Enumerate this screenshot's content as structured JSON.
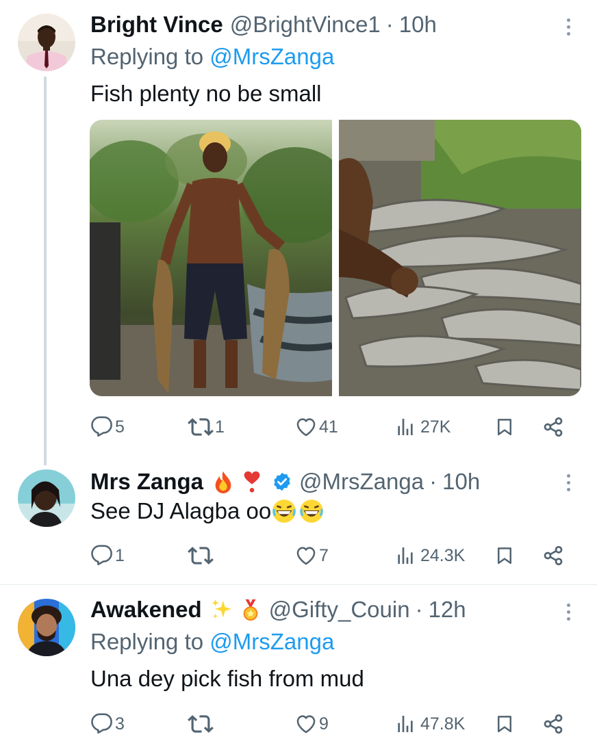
{
  "tweets": [
    {
      "name": "Bright Vince",
      "handle": "@BrightVince1",
      "time": "10h",
      "replying_prefix": "Replying to",
      "replying_to": "@MrsZanga",
      "text": "Fish plenty no be small",
      "stats": {
        "replies": "5",
        "retweets": "1",
        "likes": "41",
        "views": "27K"
      }
    },
    {
      "name": "Mrs Zanga",
      "handle": "@MrsZanga",
      "time": "10h",
      "text": "See DJ Alagba oo",
      "verified": true,
      "stats": {
        "replies": "1",
        "retweets": "",
        "likes": "7",
        "views": "24.3K"
      }
    },
    {
      "name": "Awakened",
      "handle": "@Gifty_Couin",
      "time": "12h",
      "replying_prefix": "Replying to",
      "replying_to": "@MrsZanga",
      "text": "Una dey pick fish from mud",
      "stats": {
        "replies": "3",
        "retweets": "",
        "likes": "9",
        "views": "47.8K"
      }
    }
  ],
  "colors": {
    "accent": "#1d9bf0",
    "secondary": "#536471",
    "text": "#0f1419",
    "verified": "#1d9bf0"
  },
  "icons": [
    "reply-icon",
    "retweet-icon",
    "like-icon",
    "views-icon",
    "bookmark-icon",
    "share-icon",
    "more-icon",
    "verified-badge-icon",
    "fire-emoji",
    "heart-emoji",
    "sparkles-emoji",
    "medal-emoji",
    "laughing-emoji"
  ]
}
